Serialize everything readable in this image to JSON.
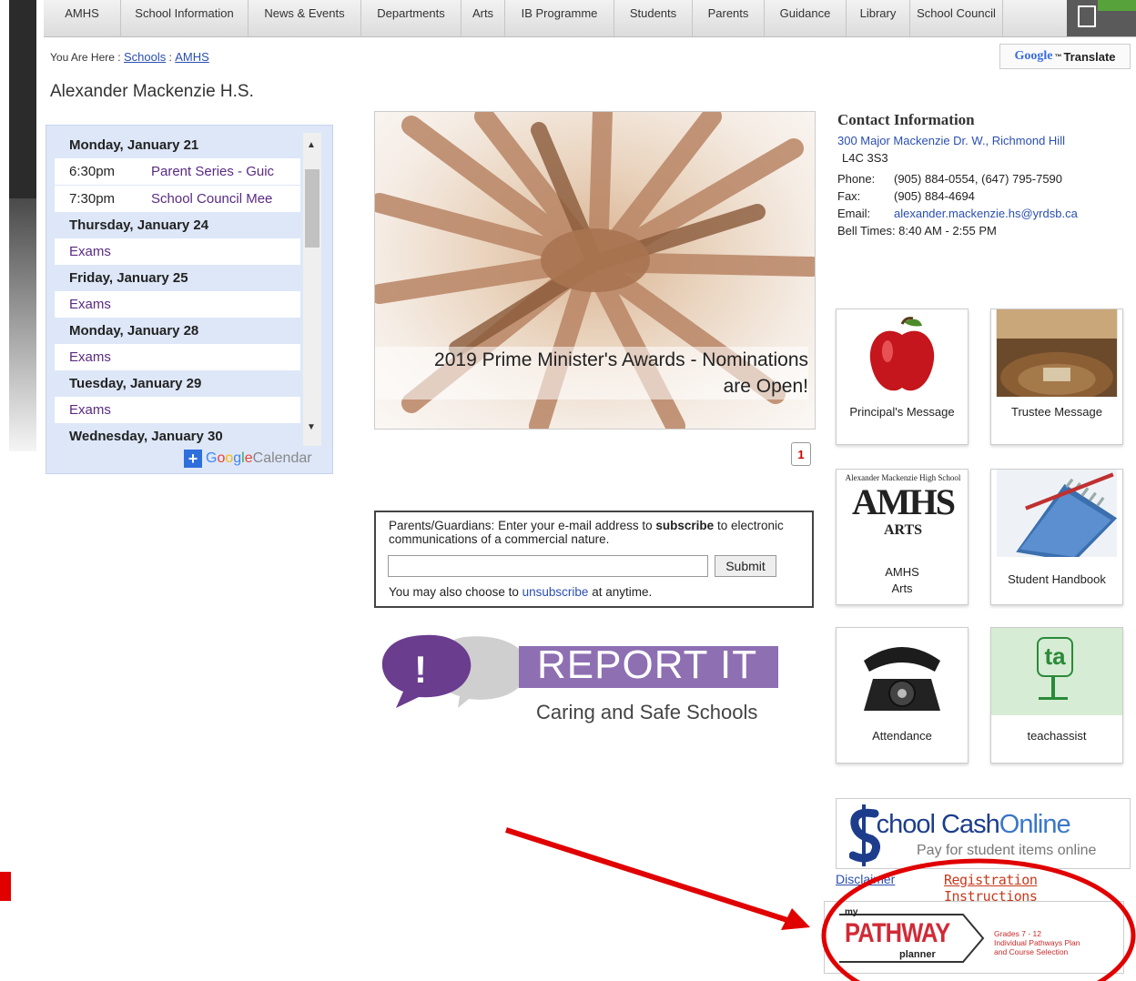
{
  "nav": {
    "items": [
      "AMHS",
      "School Information",
      "News & Events",
      "Departments",
      "Arts",
      "IB Programme",
      "Students",
      "Parents",
      "Guidance",
      "Library",
      "School Council"
    ],
    "print_icon": "printer-icon"
  },
  "breadcrumb": {
    "prefix": "You Are Here :",
    "links": [
      "Schools",
      "AMHS"
    ],
    "sep": ":"
  },
  "translate": {
    "google": "Google",
    "tm": "™",
    "label": "Translate"
  },
  "page_title": "Alexander Mackenzie H.S.",
  "calendar": {
    "days": [
      {
        "day": "Monday, January 21",
        "events": [
          {
            "time": "6:30pm",
            "title": "Parent Series - Guic"
          },
          {
            "time": "7:30pm",
            "title": "School Council Mee"
          }
        ]
      },
      {
        "day": "Thursday, January 24",
        "events": [
          {
            "time": "",
            "title": "Exams"
          }
        ]
      },
      {
        "day": "Friday, January 25",
        "events": [
          {
            "time": "",
            "title": "Exams"
          }
        ]
      },
      {
        "day": "Monday, January 28",
        "events": [
          {
            "time": "",
            "title": "Exams"
          }
        ]
      },
      {
        "day": "Tuesday, January 29",
        "events": [
          {
            "time": "",
            "title": "Exams"
          }
        ]
      },
      {
        "day": "Wednesday, January 30",
        "events": []
      }
    ],
    "plus": "+",
    "google_letters": [
      "G",
      "o",
      "o",
      "g",
      "l",
      "e"
    ],
    "google_colors": [
      "#4285f4",
      "#ea4335",
      "#fbbc05",
      "#4285f4",
      "#34a853",
      "#ea4335"
    ],
    "calendar_word": "Calendar"
  },
  "hero": {
    "caption_line1": "2019 Prime Minister's Awards - Nominations",
    "caption_line2": "are Open!",
    "page": "1"
  },
  "subscribe": {
    "text_before": "Parents/Guardians: Enter your e-mail address to",
    "text_bold": "subscribe",
    "text_after": "to electronic communications of a commercial nature.",
    "input_value": "",
    "submit": "Submit",
    "foot_before": "You may also choose to",
    "foot_link": "unsubscribe",
    "foot_after": "at anytime."
  },
  "report": {
    "title": "REPORT IT",
    "subtitle": "Caring and Safe Schools",
    "bang": "!"
  },
  "contact": {
    "heading": "Contact Information",
    "address_link": "300 Major Mackenzie Dr. W., Richmond Hill",
    "postal": "L4C 3S3",
    "phone_label": "Phone:",
    "phone": "(905) 884-0554, (647) 795-7590",
    "fax_label": "Fax:",
    "fax": "(905) 884-4694",
    "email_label": "Email:",
    "email": "alexander.mackenzie.hs@yrdsb.ca",
    "bell": "Bell Times: 8:40 AM - 2:55 PM"
  },
  "tiles": {
    "principal": "Principal's Message",
    "trustee": "Trustee Message",
    "arts_logo_top": "Alexander Mackenzie High School",
    "arts_logo_big": "AMHS",
    "arts_logo_sub": "ARTS",
    "arts": "AMHS Arts",
    "handbook": "Student Handbook",
    "attendance": "Attendance",
    "teachassist": "teachassist",
    "ta_logo": "ta"
  },
  "school_cash": {
    "title_s": "S",
    "title_rest": "chool Cash",
    "title_online": "Online",
    "tagline": "Pay for student items online",
    "disclaimer": "Disclaimer",
    "registration": "Registration Instructions"
  },
  "pathway": {
    "my": "my",
    "title": "PATHWAY",
    "planner": "planner",
    "grades": "Grades 7 - 12",
    "line2": "Individual Pathways Plan",
    "line3": "and Course Selection"
  },
  "colors": {
    "annotation": "#e00000",
    "report_purple": "#8e6fb2",
    "link": "#2a4fb0"
  }
}
